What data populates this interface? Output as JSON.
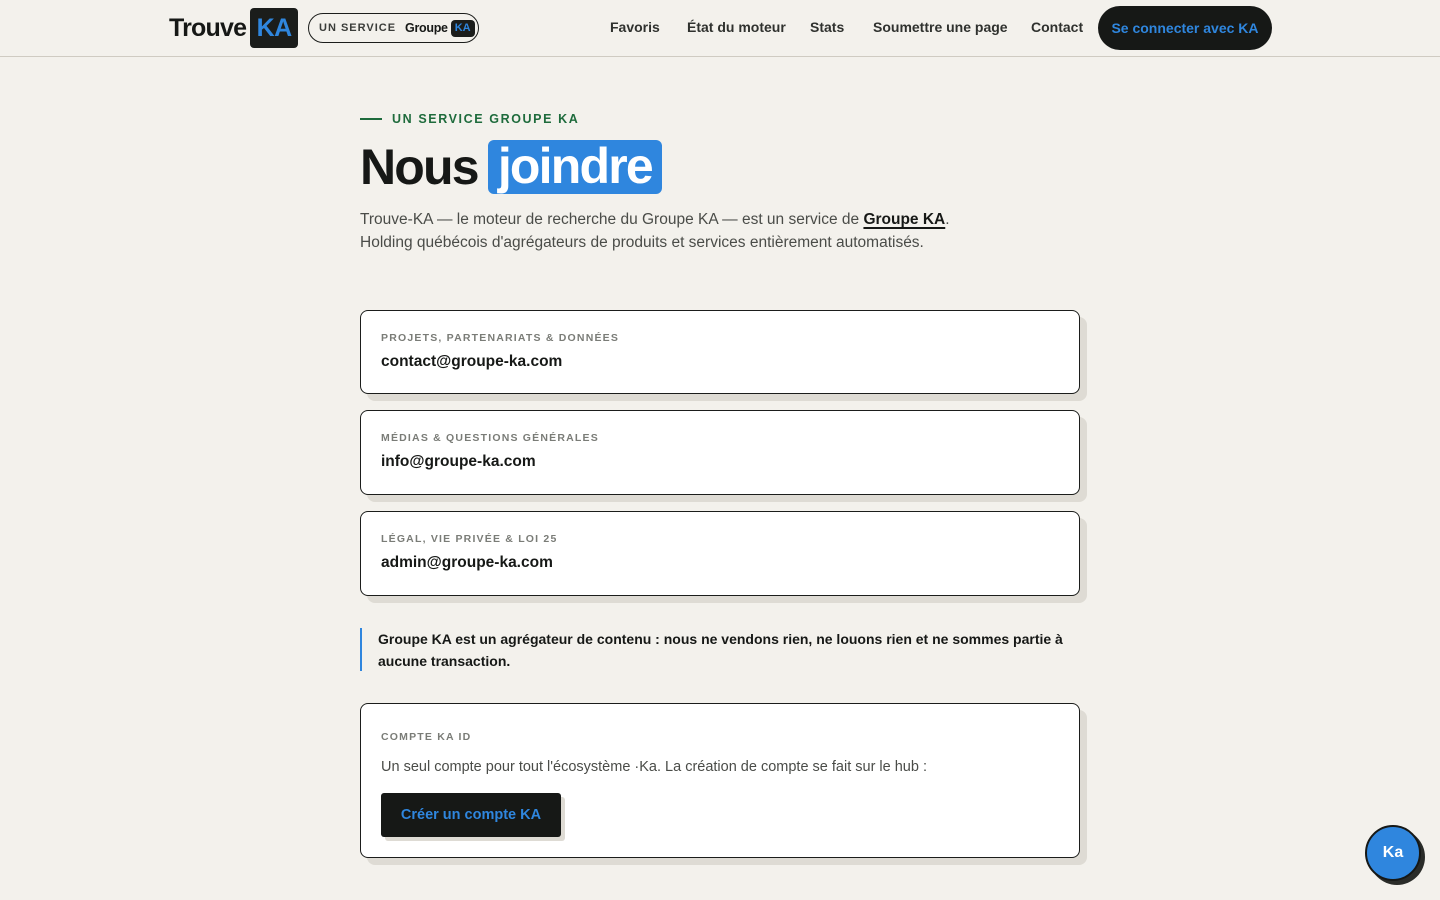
{
  "header": {
    "logo_word": "Trouve",
    "logo_box": "KA",
    "pill_label": "UN SERVICE",
    "pill_groupe": "Groupe",
    "pill_ka": "KA",
    "nav": [
      "Favoris",
      "État du moteur",
      "Stats",
      "Soumettre une page",
      "Contact"
    ],
    "login_label": "Se connecter avec KA"
  },
  "main": {
    "eyebrow": "UN SERVICE GROUPE KA",
    "title_plain": "Nous",
    "title_highlight": "joindre",
    "intro_before": "Trouve-KA — le moteur de recherche du Groupe KA — est un service de ",
    "intro_link": "Groupe KA",
    "intro_after": ". Holding québécois d'agrégateurs de produits et services entièrement automatisés.",
    "contacts": [
      {
        "label": "PROJETS, PARTENARIATS & DONNÉES",
        "email": "contact@groupe-ka.com"
      },
      {
        "label": "MÉDIAS & QUESTIONS GÉNÉRALES",
        "email": "info@groupe-ka.com"
      },
      {
        "label": "LÉGAL, VIE PRIVÉE & LOI 25",
        "email": "admin@groupe-ka.com"
      }
    ],
    "note": "Groupe KA est un agrégateur de contenu : nous ne vendons rien, ne louons rien et ne sommes partie à aucune transaction.",
    "account": {
      "label": "COMPTE KA ID",
      "text": "Un seul compte pour tout l'écosystème ·Ka. La création de compte se fait sur le hub :",
      "button": "Créer un compte KA"
    }
  },
  "fab": {
    "label": "Ka"
  },
  "colors": {
    "accent": "#2f86de",
    "dark": "#161816",
    "background": "#f3f1ec",
    "eyebrow_green": "#1e6b3c"
  }
}
